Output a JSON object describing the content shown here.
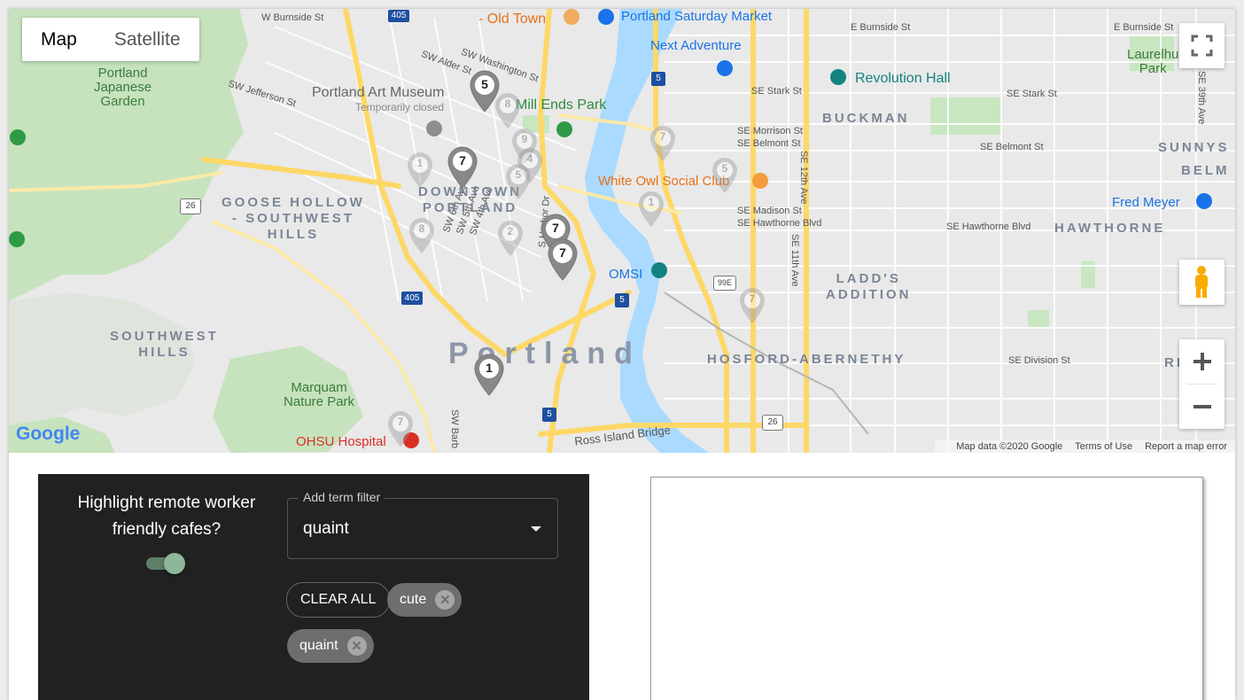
{
  "map": {
    "map_type_buttons": [
      "Map",
      "Satellite"
    ],
    "active_map_type": "Map",
    "attribution": {
      "data": "Map data ©2020 Google",
      "terms": "Terms of Use",
      "report": "Report a map error"
    },
    "logo_text": "Google",
    "streets": {
      "w_burnside": "W Burnside St",
      "sw_alder": "SW Alder St",
      "sw_washington": "SW Washington St",
      "sw_jefferson": "SW Jefferson St",
      "e_burnside": "E Burnside St",
      "e_burnside2": "E Burnside St",
      "se_stark": "SE Stark St",
      "se_stark2": "SE Stark St",
      "se_morrison": "SE Morrison St",
      "se_belmont": "SE Belmont St",
      "se_belmont2": "SE Belmont St",
      "se_madison": "SE Madison St",
      "se_hawthorne": "SE Hawthorne Blvd",
      "se_hawthorne2": "SE Hawthorne Blvd",
      "se_12th": "SE 12th Ave",
      "se_11th": "SE 11th Ave",
      "se_division": "SE Division St",
      "sw_6th": "SW 6th Ave",
      "sw_5th": "SW 5th Ave",
      "sw_4th": "SW 4th Ave",
      "s_harbor": "S Harbor Dr",
      "ross_island": "Ross Island Bridge",
      "se_39th": "SE 39th Ave",
      "sw_barb": "SW Barb"
    },
    "districts": {
      "goose_hollow": "GOOSE HOLLOW\n- SOUTHWEST\nHILLS",
      "downtown": "DOWNTOWN\nPORTLAND",
      "buckman": "BUCKMAN",
      "ladds": "LADD'S\nADDITION",
      "hosford": "HOSFORD-ABERNETHY",
      "southwest_hills": "SOUTHWEST\nHILLS",
      "hawthorne": "HAWTHORNE",
      "sunnyside": "SUNNYS",
      "belmont": "BELM",
      "ri": "RI",
      "portland": "Portland"
    },
    "pois": {
      "old_town": "- Old Town",
      "saturday_market": "Portland Saturday Market",
      "next_adventure": "Next Adventure",
      "revolution_hall": "Revolution Hall",
      "laurelhurst": "Laurelhu\nPark",
      "japanese_garden": "Portland\nJapanese\nGarden",
      "art_museum": "Portland Art Museum",
      "art_museum_sub": "Temporarily closed",
      "mill_ends": "Mill Ends Park",
      "white_owl": "White Owl Social Club",
      "fred_meyer": "Fred Meyer",
      "omsi": "OMSI",
      "marquam": "Marquam\nNature Park",
      "ohsu": "OHSU Hospital"
    },
    "highway_shields": [
      "405",
      "5",
      "26",
      "405",
      "5",
      "99E",
      "5",
      "26"
    ],
    "markers": [
      {
        "label": "5"
      },
      {
        "label": "7"
      },
      {
        "label": "7"
      },
      {
        "label": "7"
      },
      {
        "label": "1"
      }
    ],
    "ghost_markers": [
      "8",
      "9",
      "4",
      "5",
      "1",
      "7",
      "5",
      "1",
      "8",
      "2",
      "7",
      "7"
    ]
  },
  "controls": {
    "toggle_label": "Highlight remote worker friendly cafes?",
    "toggle_on": true,
    "filter_legend": "Add term filter",
    "filter_value": "quaint",
    "clear_all_label": "CLEAR ALL",
    "chips": [
      "cute",
      "quaint"
    ]
  },
  "colors": {
    "water": "#aadaff",
    "park": "#c8e6c0",
    "highway": "#fdd867",
    "panel_bg": "#212121",
    "toggle_thumb": "#8db79a"
  }
}
